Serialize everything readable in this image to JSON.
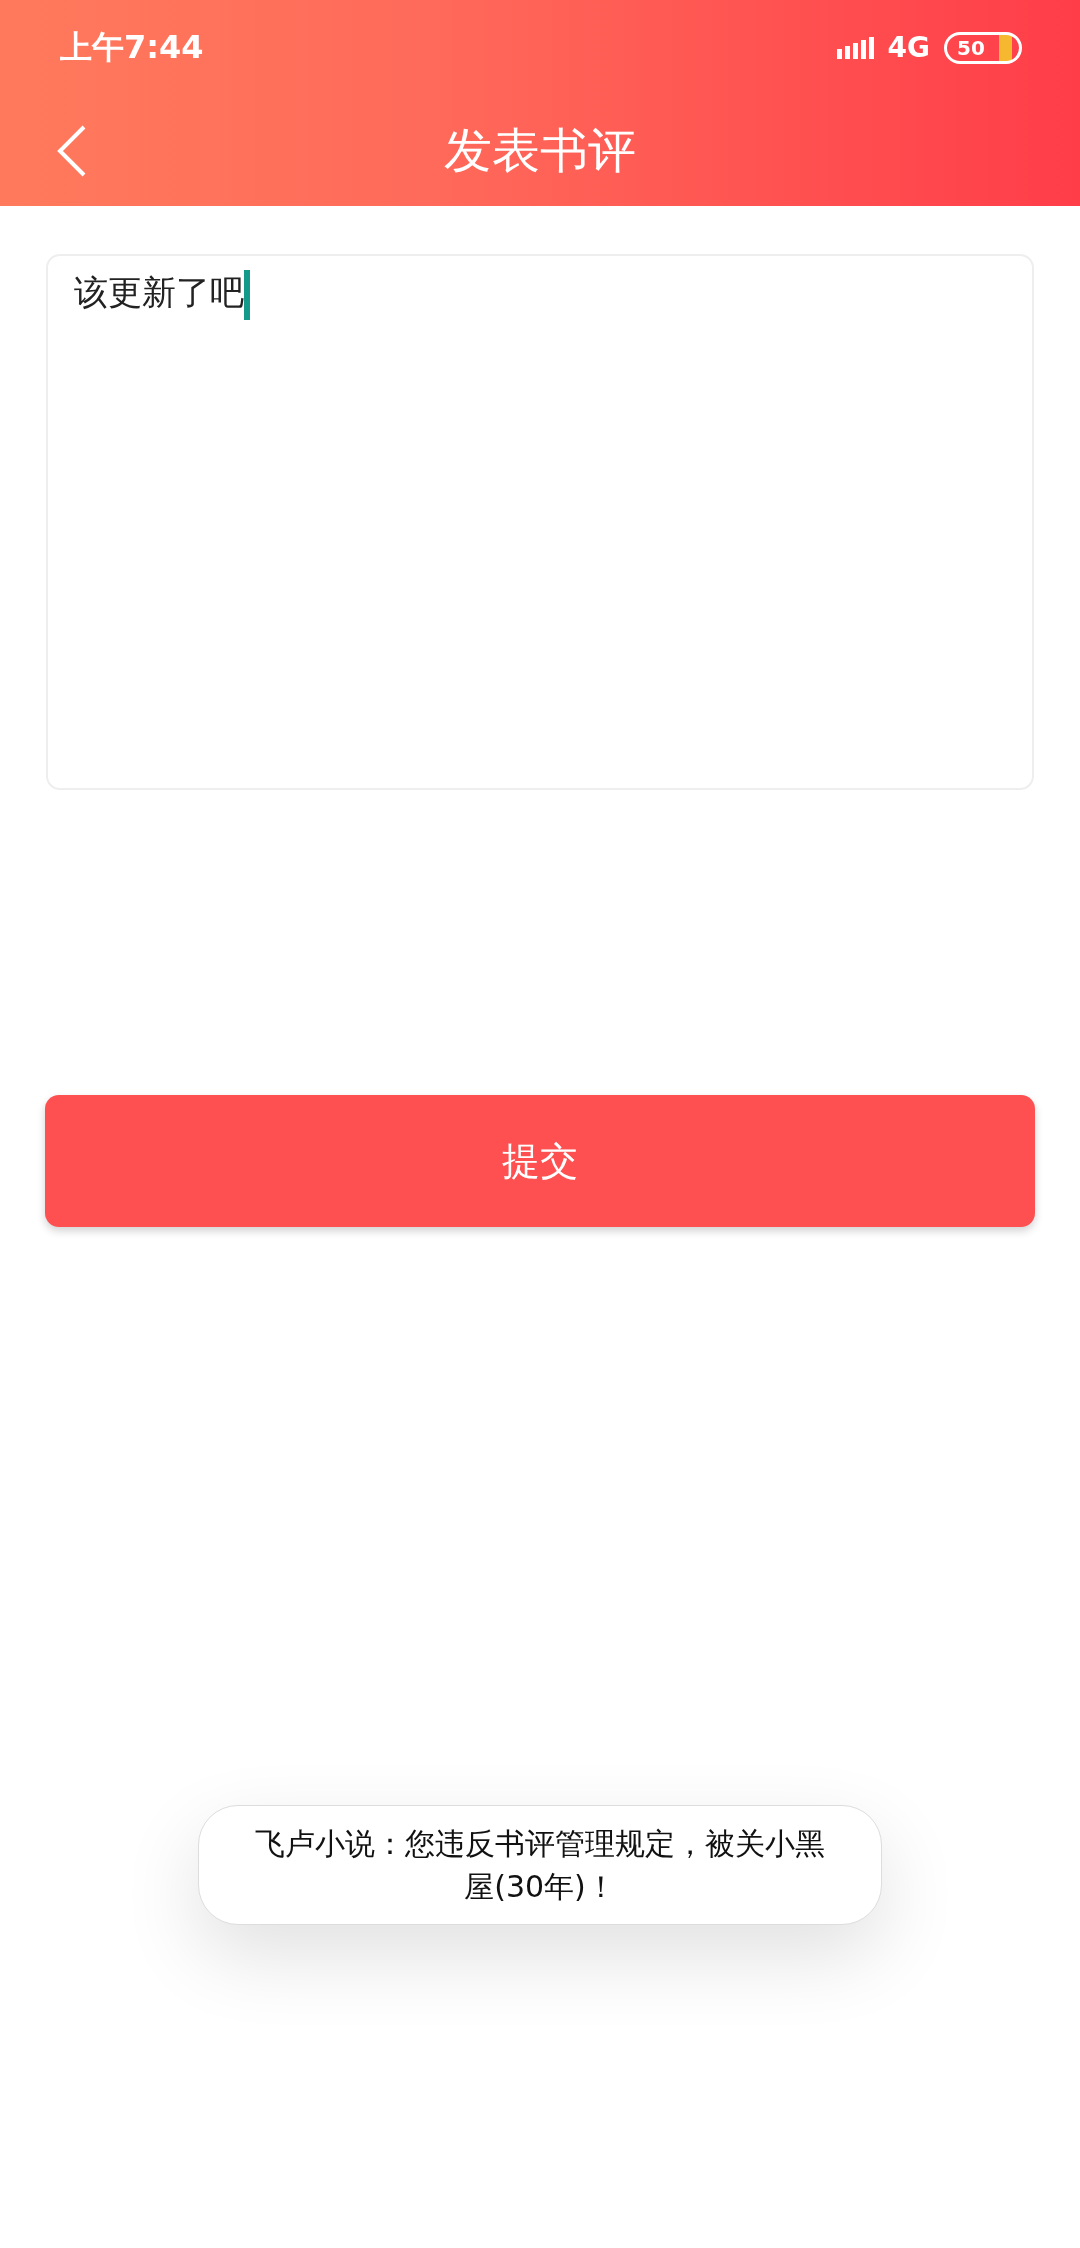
{
  "status_bar": {
    "time": "上午7:44",
    "network": "4G",
    "battery": "50"
  },
  "header": {
    "title": "发表书评"
  },
  "review": {
    "value": "该更新了吧"
  },
  "submit_button": {
    "label": "提交"
  },
  "toast": {
    "message": "飞卢小说：您违反书评管理规定，被关小黑屋(30年)！"
  }
}
